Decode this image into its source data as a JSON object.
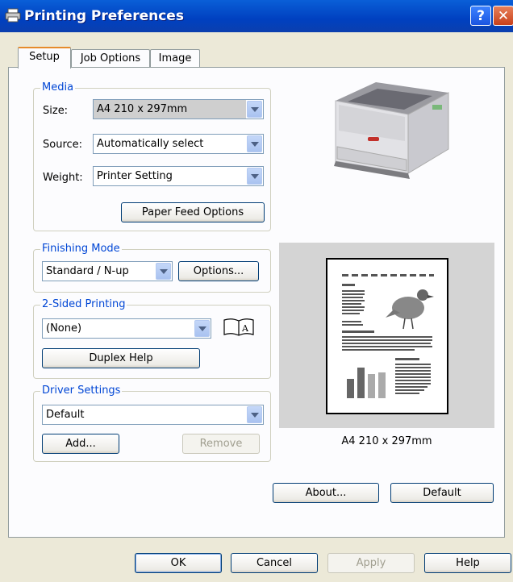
{
  "window": {
    "title": "Printing Preferences"
  },
  "tabs": [
    {
      "label": "Setup"
    },
    {
      "label": "Job Options"
    },
    {
      "label": "Image"
    }
  ],
  "media": {
    "legend": "Media",
    "size_label": "Size:",
    "size_value": "A4 210 x 297mm",
    "source_label": "Source:",
    "source_value": "Automatically select",
    "weight_label": "Weight:",
    "weight_value": "Printer Setting",
    "paper_feed_button": "Paper Feed Options"
  },
  "finishing": {
    "legend": "Finishing Mode",
    "mode_value": "Standard / N-up",
    "options_button": "Options..."
  },
  "duplex": {
    "legend": "2-Sided Printing",
    "value": "(None)",
    "help_button": "Duplex Help"
  },
  "driver": {
    "legend": "Driver Settings",
    "value": "Default",
    "add_button": "Add...",
    "remove_button": "Remove"
  },
  "preview": {
    "caption": "A4 210 x 297mm"
  },
  "page_buttons": {
    "about": "About...",
    "default": "Default"
  },
  "dialog_buttons": {
    "ok": "OK",
    "cancel": "Cancel",
    "apply": "Apply",
    "help": "Help"
  },
  "icons": [
    "printer-icon",
    "help-icon",
    "close-icon",
    "book-duplex-icon",
    "printer-image",
    "page-preview"
  ]
}
